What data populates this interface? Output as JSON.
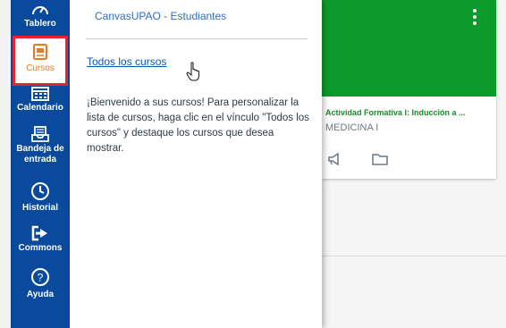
{
  "nav": {
    "items": [
      {
        "label": "Tablero",
        "icon": "dashboard-icon"
      },
      {
        "label": "Cursos",
        "icon": "courses-icon"
      },
      {
        "label": "Calendario",
        "icon": "calendar-icon"
      },
      {
        "label": "Bandeja de entrada",
        "icon": "inbox-icon"
      },
      {
        "label": "Historial",
        "icon": "history-icon"
      },
      {
        "label": "Commons",
        "icon": "commons-icon"
      },
      {
        "label": "Ayuda",
        "icon": "help-icon"
      }
    ],
    "active_highlight_color": "#e8242b",
    "nav_bg_color": "#0a4a9c"
  },
  "tray": {
    "title": "CanvasUPAO - Estudiantes",
    "all_courses_link": "Todos los cursos",
    "message": "¡Bienvenido a sus cursos! Para personalizar la lista de cursos, haga clic en el vínculo \"Todos los cursos\" y destaque los cursos que desea mostrar."
  },
  "course_card": {
    "color": "#0c9a2a",
    "title": "Actividad Formativa I: Inducción a ...",
    "subtitle": "MEDICINA I",
    "icons": [
      "announcements-icon",
      "folder-icon"
    ]
  }
}
